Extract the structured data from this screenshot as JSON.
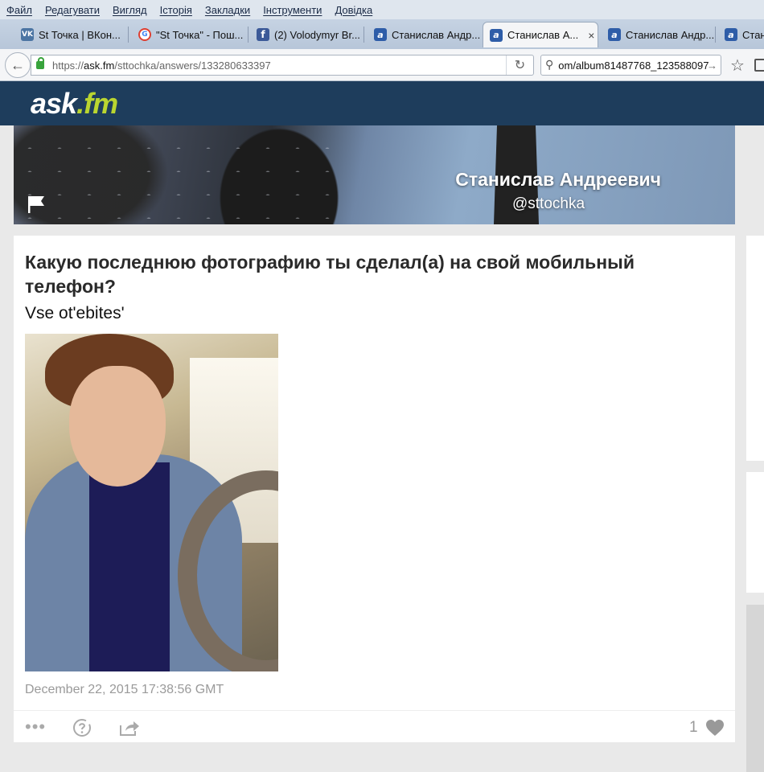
{
  "menubar": {
    "items": [
      "Файл",
      "Редагувати",
      "Вигляд",
      "Історія",
      "Закладки",
      "Інструменти",
      "Довідка"
    ]
  },
  "tabs": [
    {
      "label": "St Точка | ВКон...",
      "favicon": "vk-icon",
      "active": false
    },
    {
      "label": "\"St Точка\" - Пош...",
      "favicon": "google-icon",
      "active": false
    },
    {
      "label": "(2) Volodymyr Br...",
      "favicon": "facebook-icon",
      "active": false
    },
    {
      "label": "Станислав Андр...",
      "favicon": "askfm-icon",
      "active": false
    },
    {
      "label": "Станислав А...",
      "favicon": "askfm-icon",
      "active": true,
      "close": "×"
    },
    {
      "label": "Станислав Андр...",
      "favicon": "askfm-icon",
      "active": false
    },
    {
      "label": "Стан",
      "favicon": "askfm-icon",
      "active": false
    }
  ],
  "favicons": {
    "vk": "VK",
    "google": "G",
    "facebook": "f",
    "askfm": "a"
  },
  "navbar": {
    "back_glyph": "←",
    "url_prefix": "https://",
    "url_host": "ask.fm",
    "url_path": "/sttochka/answers/133280633397",
    "reload_glyph": "↻",
    "search_value": "om/album81487768_123588097",
    "search_go_glyph": "→",
    "search_glyph": "⚲",
    "star_glyph": "☆"
  },
  "site": {
    "logo_main": "ask",
    "logo_suffix": ".fm",
    "brand_color": "#1e3d5c",
    "accent_color": "#bad530"
  },
  "profile": {
    "name": "Станислав Андреевич",
    "handle": "@sttochka"
  },
  "post": {
    "question": "Какую последнюю фотографию ты сделал(а) на свой мобильный телефон?",
    "answer": "Vse ot'ebites'",
    "timestamp": "December 22, 2015 17:38:56 GMT",
    "like_count": "1",
    "more_glyph": "•••"
  }
}
